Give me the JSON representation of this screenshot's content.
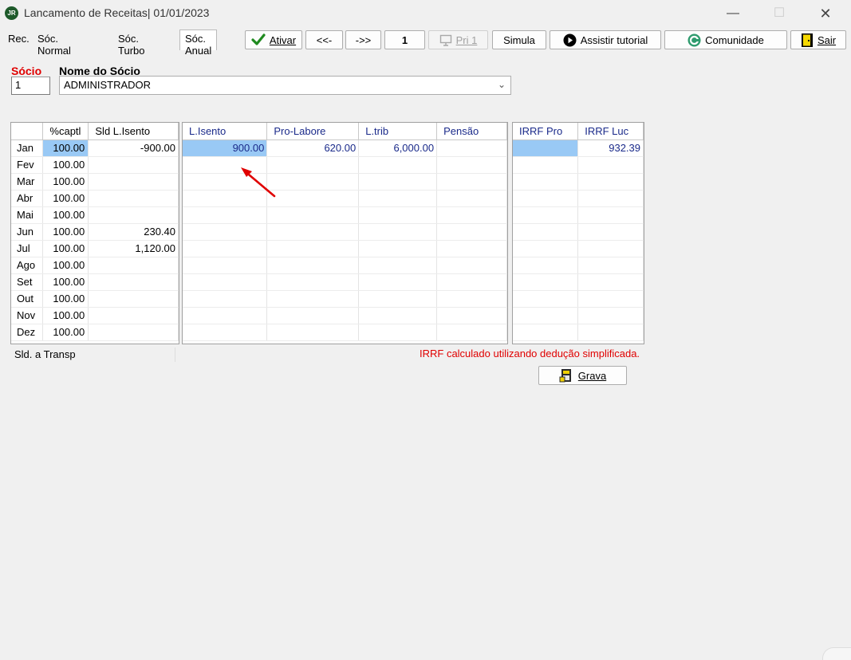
{
  "window": {
    "title": "Lancamento de Receitas| 01/01/2023",
    "app_icon_text": "JR",
    "minimize": "—",
    "maximize": "☐",
    "close": "✕"
  },
  "tabs": [
    {
      "label": "Rec."
    },
    {
      "label": "Sóc. Normal"
    },
    {
      "label": "Sóc. Turbo"
    },
    {
      "label": "Sóc. Anual"
    }
  ],
  "toolbar": {
    "ativar": "Ativar",
    "prev": "<<-",
    "next": "->>",
    "page": "1",
    "pri": "Pri 1",
    "simula": "Simula",
    "tutorial": "Assistir tutorial",
    "comunidade": "Comunidade",
    "sair": "Sair"
  },
  "form": {
    "socio_label": "Sócio",
    "socio_value": "1",
    "nome_label": "Nome do Sócio",
    "nome_value": "ADMINISTRADOR"
  },
  "grid1": {
    "headers": [
      "",
      "%captl",
      "Sld L.Isento"
    ],
    "rows": [
      {
        "month": "Jan",
        "pct": "100.00",
        "sld": "-900.00"
      },
      {
        "month": "Fev",
        "pct": "100.00",
        "sld": ""
      },
      {
        "month": "Mar",
        "pct": "100.00",
        "sld": ""
      },
      {
        "month": "Abr",
        "pct": "100.00",
        "sld": ""
      },
      {
        "month": "Mai",
        "pct": "100.00",
        "sld": ""
      },
      {
        "month": "Jun",
        "pct": "100.00",
        "sld": "230.40"
      },
      {
        "month": "Jul",
        "pct": "100.00",
        "sld": "1,120.00"
      },
      {
        "month": "Ago",
        "pct": "100.00",
        "sld": ""
      },
      {
        "month": "Set",
        "pct": "100.00",
        "sld": ""
      },
      {
        "month": "Out",
        "pct": "100.00",
        "sld": ""
      },
      {
        "month": "Nov",
        "pct": "100.00",
        "sld": ""
      },
      {
        "month": "Dez",
        "pct": "100.00",
        "sld": ""
      }
    ]
  },
  "grid2": {
    "headers": [
      "L.Isento",
      "Pro-Labore",
      "L.trib",
      "Pensão"
    ],
    "rows": [
      [
        "900.00",
        "620.00",
        "6,000.00",
        ""
      ],
      [
        "",
        "",
        "",
        ""
      ],
      [
        "",
        "",
        "",
        ""
      ],
      [
        "",
        "",
        "",
        ""
      ],
      [
        "",
        "",
        "",
        ""
      ],
      [
        "",
        "",
        "",
        ""
      ],
      [
        "",
        "",
        "",
        ""
      ],
      [
        "",
        "",
        "",
        ""
      ],
      [
        "",
        "",
        "",
        ""
      ],
      [
        "",
        "",
        "",
        ""
      ],
      [
        "",
        "",
        "",
        ""
      ],
      [
        "",
        "",
        "",
        ""
      ]
    ]
  },
  "grid3": {
    "headers": [
      "IRRF Pro",
      "IRRF Luc"
    ],
    "rows": [
      [
        "",
        "932.39"
      ],
      [
        "",
        ""
      ],
      [
        "",
        ""
      ],
      [
        "",
        ""
      ],
      [
        "",
        ""
      ],
      [
        "",
        ""
      ],
      [
        "",
        ""
      ],
      [
        "",
        ""
      ],
      [
        "",
        ""
      ],
      [
        "",
        ""
      ],
      [
        "",
        ""
      ],
      [
        "",
        ""
      ]
    ]
  },
  "footer": {
    "sld_transp": "Sld. a Transp",
    "irrf_message": "IRRF calculado utilizando dedução simplificada.",
    "grava": "Grava"
  },
  "colors": {
    "accent_red": "#e00000",
    "selection_blue": "#99c9f5",
    "header_blue": "#1a2a8a"
  },
  "icons": [
    "check-icon",
    "monitor-icon",
    "play-icon",
    "community-icon",
    "exit-door-icon",
    "save-icon"
  ]
}
